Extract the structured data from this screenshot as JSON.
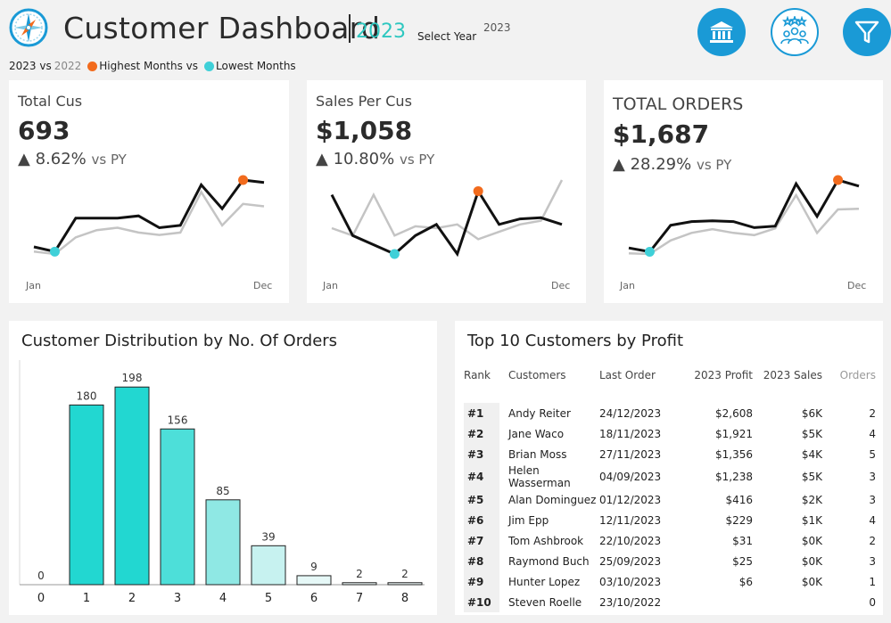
{
  "header": {
    "title": "Customer Dashboard",
    "year": "2023",
    "select_year_label": "Select Year",
    "select_year_value": "2023"
  },
  "legend": {
    "current": "2023 vs",
    "previous": "2022",
    "highest": "Highest Months vs",
    "lowest": "Lowest Months",
    "highest_color": "#f26b1d",
    "lowest_color": "#3fd0d8"
  },
  "icons": {
    "logo": "compass-icon",
    "bank": "bank-icon",
    "people": "customers-icon",
    "filter": "filter-icon"
  },
  "kpis": [
    {
      "label": "Total Cus",
      "value": "693",
      "change": "▲ 8.62%",
      "vs": "vs PY",
      "start": "Jan",
      "end": "Dec",
      "current": [
        40,
        38,
        52,
        52,
        52,
        53,
        48,
        49,
        66,
        56,
        68,
        67
      ],
      "previous": [
        38,
        37,
        44,
        47,
        48,
        46,
        45,
        46,
        63,
        49,
        58,
        57
      ],
      "low_index": 1,
      "high_index": 10
    },
    {
      "label": "Sales Per Cus",
      "value": "$1,058",
      "change": "▲ 10.80%",
      "vs": "vs PY",
      "start": "Jan",
      "end": "Dec",
      "current": [
        1120,
        1010,
        985,
        960,
        1010,
        1040,
        960,
        1130,
        1040,
        1055,
        1058,
        1040
      ],
      "previous": [
        1030,
        1010,
        1120,
        1010,
        1035,
        1030,
        1040,
        1000,
        1020,
        1040,
        1050,
        1160
      ],
      "low_index": 3,
      "high_index": 7
    },
    {
      "label": "TOTAL ORDERS",
      "value": "$1,687",
      "change": "▲ 28.29%",
      "vs": "vs PY",
      "start": "Jan",
      "end": "Dec",
      "current": [
        110,
        105,
        140,
        145,
        146,
        145,
        137,
        139,
        195,
        152,
        200,
        192
      ],
      "previous": [
        103,
        102,
        120,
        130,
        135,
        130,
        127,
        136,
        180,
        130,
        161,
        162
      ],
      "low_index": 1,
      "high_index": 10
    }
  ],
  "distribution": {
    "title": "Customer Distribution by No. Of Orders"
  },
  "chart_data": {
    "type": "bar",
    "title": "Customer Distribution by No. Of Orders",
    "categories": [
      "0",
      "1",
      "2",
      "3",
      "4",
      "5",
      "6",
      "7",
      "8"
    ],
    "values": [
      0,
      180,
      198,
      156,
      85,
      39,
      9,
      2,
      2
    ],
    "ylim": [
      0,
      200
    ],
    "grid": false,
    "colors": [
      "#1ed9d4",
      "#22d7d1",
      "#22d7d1",
      "#4ddfd9",
      "#8fe8e4",
      "#c7f2f0",
      "#e6f8f7",
      "#eef9f8",
      "#eef9f8"
    ]
  },
  "top10": {
    "title": "Top 10 Customers by Profit",
    "columns": [
      "Rank",
      "Customers",
      "Last Order",
      "2023 Profit",
      "2023 Sales",
      "Orders"
    ],
    "rows": [
      [
        "#1",
        "Andy Reiter",
        "24/12/2023",
        "$2,608",
        "$6K",
        "2"
      ],
      [
        "#2",
        "Jane Waco",
        "18/11/2023",
        "$1,921",
        "$5K",
        "4"
      ],
      [
        "#3",
        "Brian Moss",
        "27/11/2023",
        "$1,356",
        "$4K",
        "5"
      ],
      [
        "#4",
        "Helen Wasserman",
        "04/09/2023",
        "$1,238",
        "$5K",
        "3"
      ],
      [
        "#5",
        "Alan Dominguez",
        "01/12/2023",
        "$416",
        "$2K",
        "3"
      ],
      [
        "#6",
        "Jim Epp",
        "12/11/2023",
        "$229",
        "$1K",
        "4"
      ],
      [
        "#7",
        "Tom Ashbrook",
        "22/10/2023",
        "$31",
        "$0K",
        "2"
      ],
      [
        "#8",
        "Raymond Buch",
        "25/09/2023",
        "$25",
        "$0K",
        "3"
      ],
      [
        "#9",
        "Hunter Lopez",
        "03/10/2023",
        "$6",
        "$0K",
        "1"
      ],
      [
        "#10",
        "Steven Roelle",
        "23/10/2022",
        "",
        "",
        "0"
      ]
    ]
  }
}
